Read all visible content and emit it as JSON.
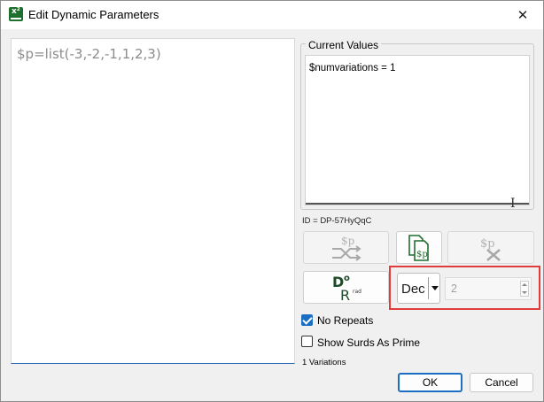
{
  "window": {
    "title": "Edit Dynamic Parameters",
    "close_glyph": "✕"
  },
  "editor": {
    "text": "$p=list(-3,-2,-1,1,2,3)"
  },
  "current_values": {
    "label": "Current Values",
    "text": "$numvariations = 1"
  },
  "id_label": "ID = DP-57HyQqC",
  "toolbar": {
    "shuffle_symbol": "$p",
    "copy_symbol": "$p",
    "clear_symbol": "$p",
    "dr_top": "D",
    "dr_top_sup": "o",
    "dr_bottom": "R",
    "dr_bottom_sup": "rad"
  },
  "number_format": {
    "selected": "Dec",
    "places_value": "2"
  },
  "options": {
    "no_repeats": {
      "label": "No Repeats",
      "checked": true
    },
    "show_surds": {
      "label": "Show Surds As Prime",
      "checked": false
    }
  },
  "variations_label": "1 Variations",
  "buttons": {
    "ok": "OK",
    "cancel": "Cancel"
  },
  "colors": {
    "accent": "#1b6ec2",
    "highlight": "#e03c3c",
    "icon_green": "#1f6f2e"
  }
}
